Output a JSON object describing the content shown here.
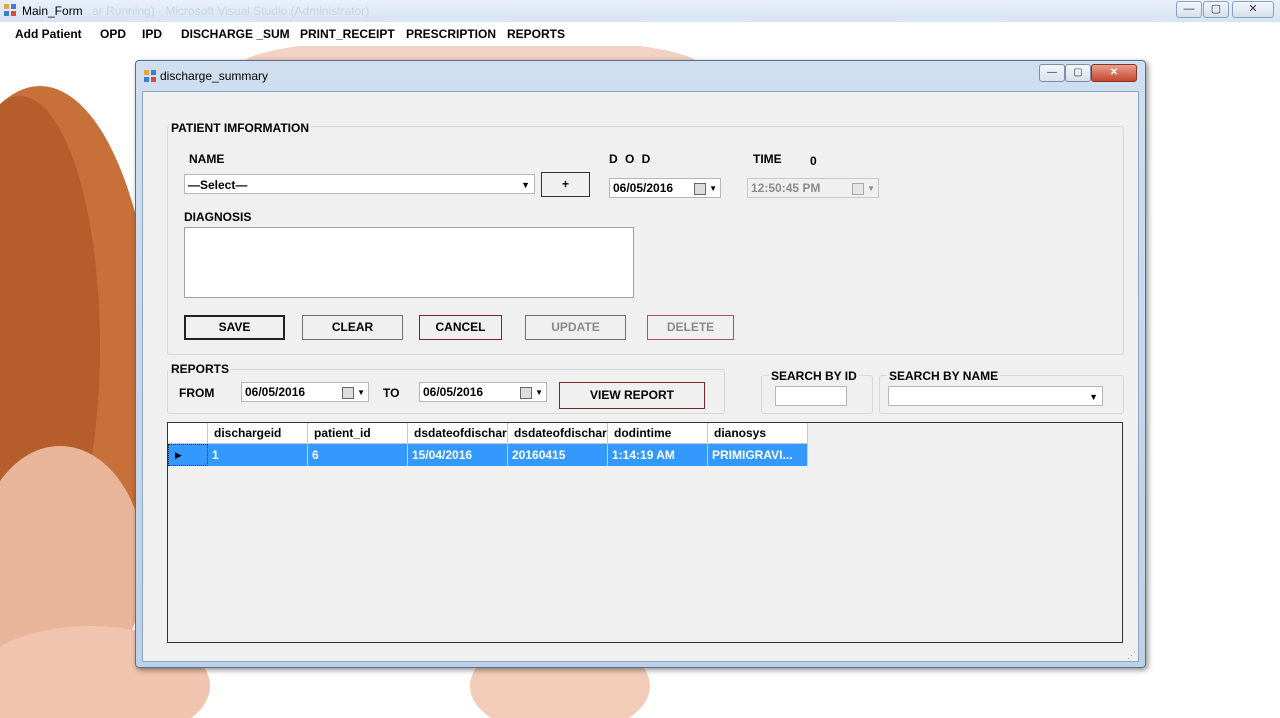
{
  "main_window": {
    "title": "Main_Form",
    "ghost_title": "ar Running) - Microsoft Visual Studio (Administrator)",
    "buttons": {
      "minimize": "—",
      "maximize": "▢",
      "close": "✕"
    }
  },
  "menu": [
    "Add Patient",
    "OPD",
    "IPD",
    "DISCHARGE _SUM",
    "PRINT_RECEIPT",
    "PRESCRIPTION",
    "REPORTS"
  ],
  "discharge_window": {
    "title": "discharge_summary",
    "buttons": {
      "minimize": "—",
      "maximize": "▢",
      "close": "✕"
    },
    "patient_info": {
      "group_label": "PATIENT IMFORMATION",
      "name_label": "NAME",
      "name_value": "—Select—",
      "add_button": "+",
      "dod_label": "D O D",
      "dod_value": "06/05/2016",
      "time_label": "TIME",
      "time_indicator": "0",
      "time_value": "12:50:45 PM",
      "diagnosis_label": "DIAGNOSIS",
      "diagnosis_value": ""
    },
    "actions": {
      "save": "SAVE",
      "clear": "CLEAR",
      "cancel": "CANCEL",
      "update": "UPDATE",
      "delete": "DELETE"
    },
    "reports": {
      "group_label": "REPORTS",
      "from_label": "FROM",
      "from_value": "06/05/2016",
      "to_label": "TO",
      "to_value": "06/05/2016",
      "view_button": "VIEW REPORT"
    },
    "search_by_id": {
      "label": "SEARCH BY ID",
      "value": ""
    },
    "search_by_name": {
      "label": "SEARCH BY NAME",
      "value": ""
    },
    "grid": {
      "columns": [
        "dischargeid",
        "patient_id",
        "dsdateofdischarge",
        "dsdateofdischarge",
        "dodintime",
        "dianosys"
      ],
      "rows": [
        [
          "1",
          "6",
          "15/04/2016",
          "20160415",
          "1:14:19 AM",
          "PRIMIGRAVI..."
        ]
      ],
      "row_indicator": "▶"
    }
  },
  "colors": {
    "selection": "#3399ff",
    "window_frame": "#bcd1e8",
    "client_bg": "#f0f0f0"
  }
}
